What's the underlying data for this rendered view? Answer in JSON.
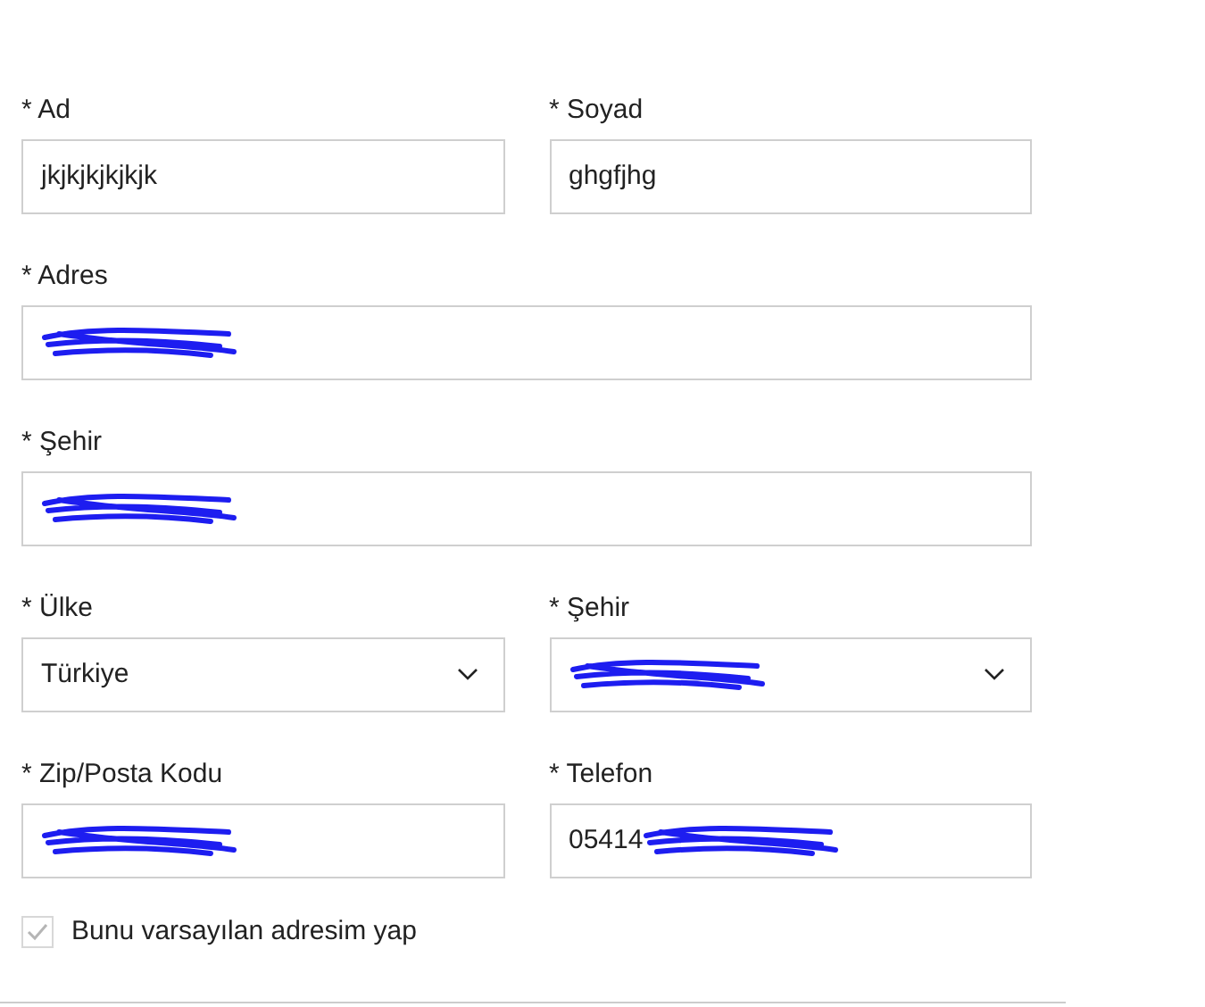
{
  "rows": [
    {
      "fields": [
        {
          "label": "* Ad",
          "kind": "text",
          "value": "jkjkjkjkjkjk",
          "redacted": false
        },
        {
          "label": "* Soyad",
          "kind": "text",
          "value": "ghgfjhg",
          "redacted": false
        }
      ]
    },
    {
      "fields": [
        {
          "label": "* Adres",
          "kind": "text",
          "redacted": true
        }
      ]
    },
    {
      "fields": [
        {
          "label": "* Şehir",
          "kind": "text",
          "redacted": true
        }
      ]
    },
    {
      "fields": [
        {
          "label": "* Ülke",
          "kind": "select",
          "value": "Türkiye",
          "redacted": false
        },
        {
          "label": "* Şehir",
          "kind": "select",
          "redacted": true
        }
      ]
    },
    {
      "fields": [
        {
          "label": "* Zip/Posta Kodu",
          "kind": "text",
          "redacted": true
        },
        {
          "label": "* Telefon",
          "kind": "text",
          "value": "05414",
          "redacted": true
        }
      ]
    }
  ],
  "default_address": {
    "label": "Bunu varsayılan adresim yap",
    "checked": true,
    "disabled": true
  }
}
